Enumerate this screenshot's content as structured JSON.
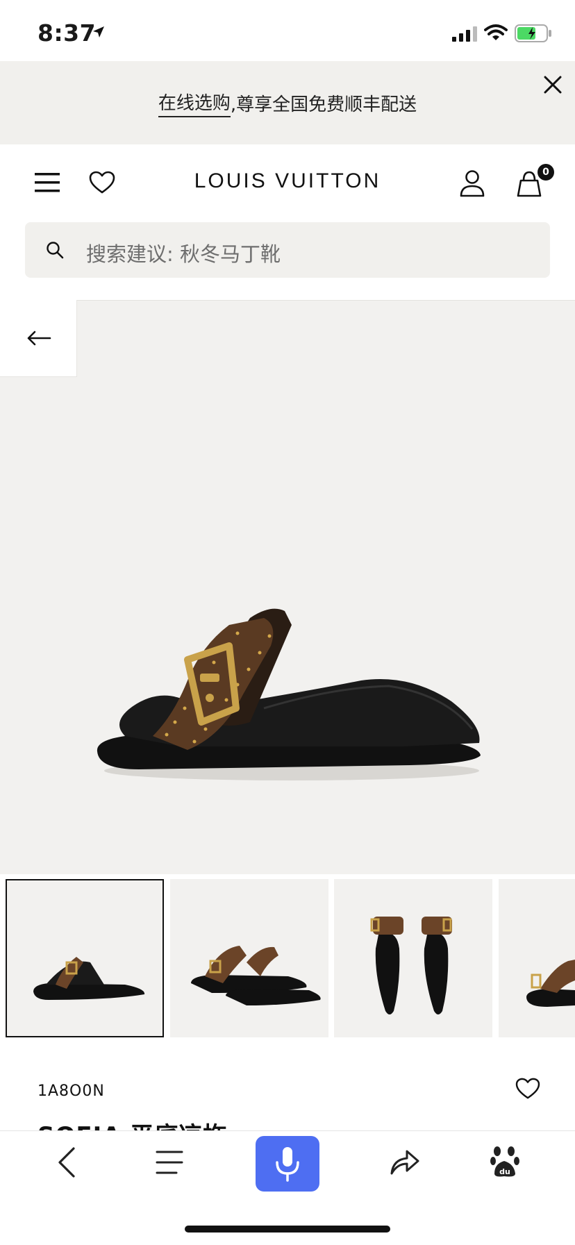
{
  "status_bar": {
    "time": "8:37"
  },
  "promo": {
    "link_text": "在线选购",
    "text": ",尊享全国免费顺丰配送"
  },
  "header": {
    "brand": "LOUIS VUITTON",
    "bag_count": "0"
  },
  "search": {
    "placeholder": "搜索建议: 秋冬马丁靴"
  },
  "product": {
    "sku": "1A8O0N",
    "title_partial": "SOFIA 平底凉拖",
    "thumbnail_count": 4,
    "selected_thumbnail": 1
  },
  "colors": {
    "banner_bg": "#f1f0ed",
    "hero_bg": "#f2f1ef",
    "mic_button": "#4e6ef2"
  },
  "icons": [
    "location-arrow-icon",
    "signal-icon",
    "wifi-icon",
    "battery-icon",
    "close-icon",
    "hamburger-menu-icon",
    "heart-icon",
    "person-icon",
    "shopping-bag-icon",
    "search-icon",
    "arrow-left-icon",
    "chevron-left-icon",
    "list-icon",
    "microphone-icon",
    "share-icon",
    "baidu-paw-icon"
  ]
}
